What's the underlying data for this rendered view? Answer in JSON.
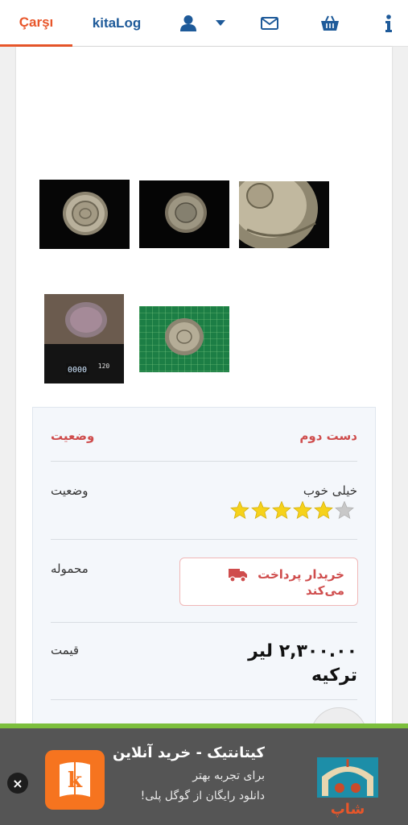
{
  "topbar": {
    "tab_carsi": "Çarşı",
    "tab_kitalog": "kitaLog",
    "icons": [
      "user-icon",
      "chevron-down-icon",
      "mail-icon",
      "basket-icon",
      "info-icon"
    ]
  },
  "gallery": {
    "icons": [
      "coin-bowl-photo-1",
      "coin-bowl-photo-2",
      "coin-bowl-closeup-photo",
      "scale-photo",
      "cutting-mat-photo"
    ],
    "scale_readout": "0000",
    "scale_unit": "120"
  },
  "details": {
    "condition_header_value": "دست دوم",
    "condition_header_label": "وضعیت",
    "rating_text": "خیلی خوب",
    "rating_label": "وضعیت",
    "rating_stars": 5,
    "rating_max": 6,
    "shipping_label": "محموله",
    "shipping_value_line1": "خریدار پرداخت",
    "shipping_value_line2": "می‌کند",
    "price_label": "قیمت",
    "price_line1": "۲,۳۰۰.۰۰ لیر",
    "price_line2": "ترکیه"
  },
  "ad": {
    "title": "کیتانتیک - خرید آنلاین",
    "subtitle": "برای تجربه بهتر",
    "cta": "دانلود رایگان از گوگل پلی!",
    "logo_text": "شاپ",
    "close_label": "×"
  },
  "colors": {
    "accent_orange": "#e8562a",
    "brand_blue": "#1e5a99",
    "header_red": "#cf4d4d",
    "star_yellow": "#f6d21b",
    "ad_green": "#7cbf3c"
  }
}
